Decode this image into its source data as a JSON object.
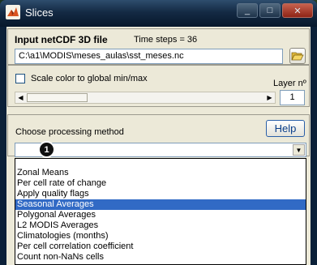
{
  "window": {
    "title": "Slices",
    "controls": {
      "minimize": "_",
      "maximize": "□",
      "close": "✕"
    }
  },
  "input_panel": {
    "heading": "Input netCDF 3D file",
    "time_steps": "Time steps = 36",
    "file_path": "C:\\a1\\MODIS\\meses_aulas\\sst_meses.nc",
    "open_icon": "folder-open-icon"
  },
  "scale_option": {
    "label": "Scale color to global min/max",
    "checked": false
  },
  "layer": {
    "label": "Layer nº",
    "value": "1"
  },
  "processing": {
    "label": "Choose processing method",
    "help_label": "Help",
    "selected": "",
    "badge": "1",
    "options": [
      "Zonal Means",
      "Per cell rate of change",
      "Apply quality flags",
      "Seasonal Averages",
      "Polygonal Averages",
      "L2 MODIS Averages",
      "Climatologies (months)",
      "Per cell correlation coefficient",
      "Count non-NaNs cells"
    ],
    "highlighted_index": 3
  }
}
